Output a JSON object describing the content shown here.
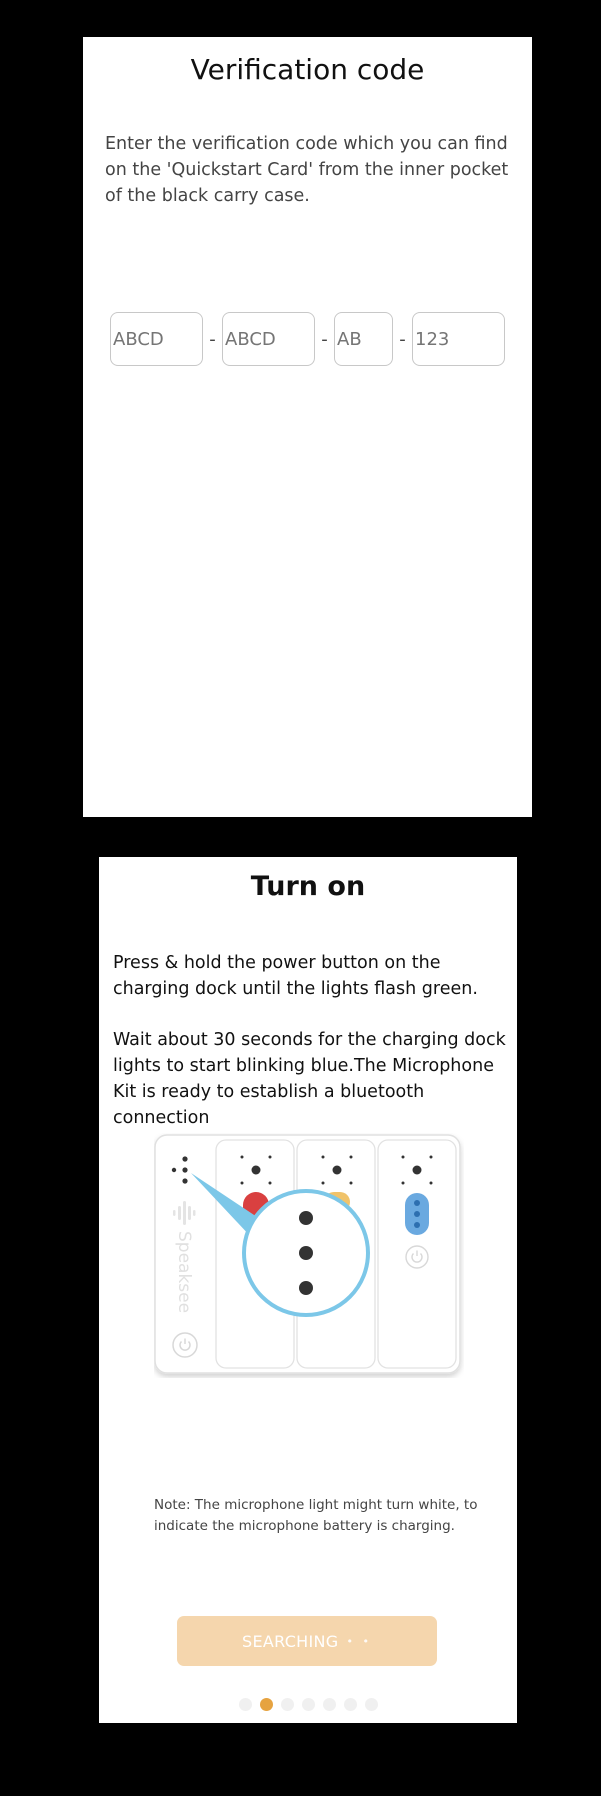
{
  "verification": {
    "title": "Verification code",
    "description": "Enter the verification code which you can find on the 'Quickstart Card' from the inner pocket of the black carry case.",
    "code_fields": [
      {
        "placeholder": "ABCD"
      },
      {
        "placeholder": "ABCD"
      },
      {
        "placeholder": "AB"
      },
      {
        "placeholder": "123"
      }
    ],
    "separator": "-"
  },
  "turn_on": {
    "title": "Turn on",
    "paragraph_1": "Press & hold the power button on the charging dock until the lights flash green.",
    "paragraph_2": "Wait about 30 seconds for the charging dock lights to start blinking blue.The Microphone Kit is ready to establish a bluetooth connection",
    "illustration": {
      "brand": "Speaksee",
      "icon": "power-icon"
    },
    "note": "Note: The microphone light might turn white, to indicate the microphone battery is charging.",
    "button_label": "SEARCHING",
    "button_dots": "• •",
    "pager": {
      "total": 7,
      "active_index": 1
    }
  },
  "colors": {
    "background": "#000000",
    "card": "#ffffff",
    "accent": "#e6a340",
    "button_disabled": "#f5d6ad",
    "highlight_blue": "#7cc7e8",
    "led_blue": "#6aa9e0",
    "led_red": "#d94040"
  }
}
